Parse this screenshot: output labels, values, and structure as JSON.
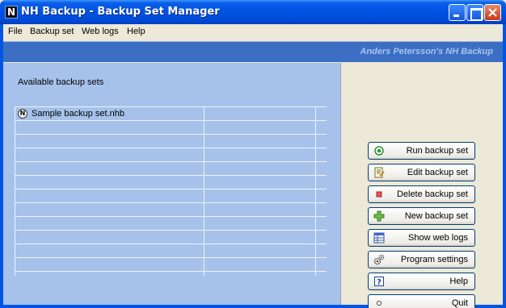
{
  "window": {
    "title": "NH Backup - Backup Set Manager",
    "icon": "N"
  },
  "menu": [
    {
      "label": "File"
    },
    {
      "label": "Backup set"
    },
    {
      "label": "Web logs"
    },
    {
      "label": "Help"
    }
  ],
  "banner": {
    "text": "Anders Petersson's NH Backup"
  },
  "list": {
    "caption": "Available backup sets",
    "row_icon": "N",
    "items": [
      {
        "name": "Sample backup set.nhb"
      }
    ]
  },
  "actions": [
    {
      "label": "Run backup set",
      "icon": "radio-dot-icon"
    },
    {
      "label": "Edit backup set",
      "icon": "edit-document-icon"
    },
    {
      "label": "Delete backup set",
      "icon": "delete-square-icon"
    },
    {
      "label": "New backup set",
      "icon": "plus-icon"
    },
    {
      "label": "Show web logs",
      "icon": "log-table-icon"
    },
    {
      "label": "Program settings",
      "icon": "gears-icon"
    },
    {
      "label": "Help",
      "icon": "help-icon"
    },
    {
      "label": "Quit",
      "icon": "circle-icon"
    }
  ],
  "colors": {
    "titlebar": "#0054e3",
    "banner": "#3c6ec4",
    "banner_text": "#a9c3ef",
    "list_panel": "#a6c2ea",
    "button_border": "#003c74"
  }
}
